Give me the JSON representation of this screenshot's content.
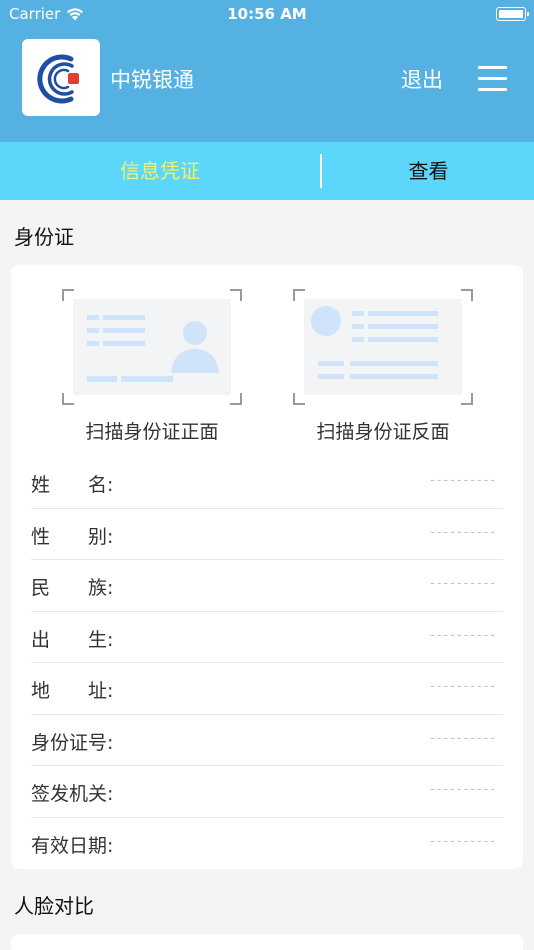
{
  "status_bar": {
    "carrier": "Carrier",
    "time": "10:56 AM"
  },
  "header": {
    "app_name": "中锐银通",
    "logout": "退出"
  },
  "tabs": {
    "info": "信息凭证",
    "view": "查看"
  },
  "id_section": {
    "title": "身份证",
    "scan_front": "扫描身份证正面",
    "scan_back": "扫描身份证反面",
    "fields": [
      {
        "label": "姓　　名:",
        "value": "----------"
      },
      {
        "label": "性　　别:",
        "value": "----------"
      },
      {
        "label": "民　　族:",
        "value": "----------"
      },
      {
        "label": "出　　生:",
        "value": "----------"
      },
      {
        "label": "地　　址:",
        "value": "----------"
      },
      {
        "label": "身份证号:",
        "value": "----------"
      },
      {
        "label": "签发机关:",
        "value": "----------"
      },
      {
        "label": "有效日期:",
        "value": "----------"
      }
    ]
  },
  "face_section": {
    "title": "人脸对比"
  },
  "icons": {
    "logo": "brand-logo-icon",
    "menu": "hamburger-menu-icon",
    "wifi": "wifi-icon",
    "battery": "battery-icon",
    "id_front": "id-card-front-icon",
    "id_back": "id-card-back-icon"
  },
  "colors": {
    "header_bg": "#56b1e3",
    "tab_bg": "#5dd6fb",
    "tab_active_text": "#f2f06a",
    "logo_blue": "#1f4fa5",
    "logo_red": "#e0402e",
    "id_graphic_blue": "#cfe3fb"
  }
}
